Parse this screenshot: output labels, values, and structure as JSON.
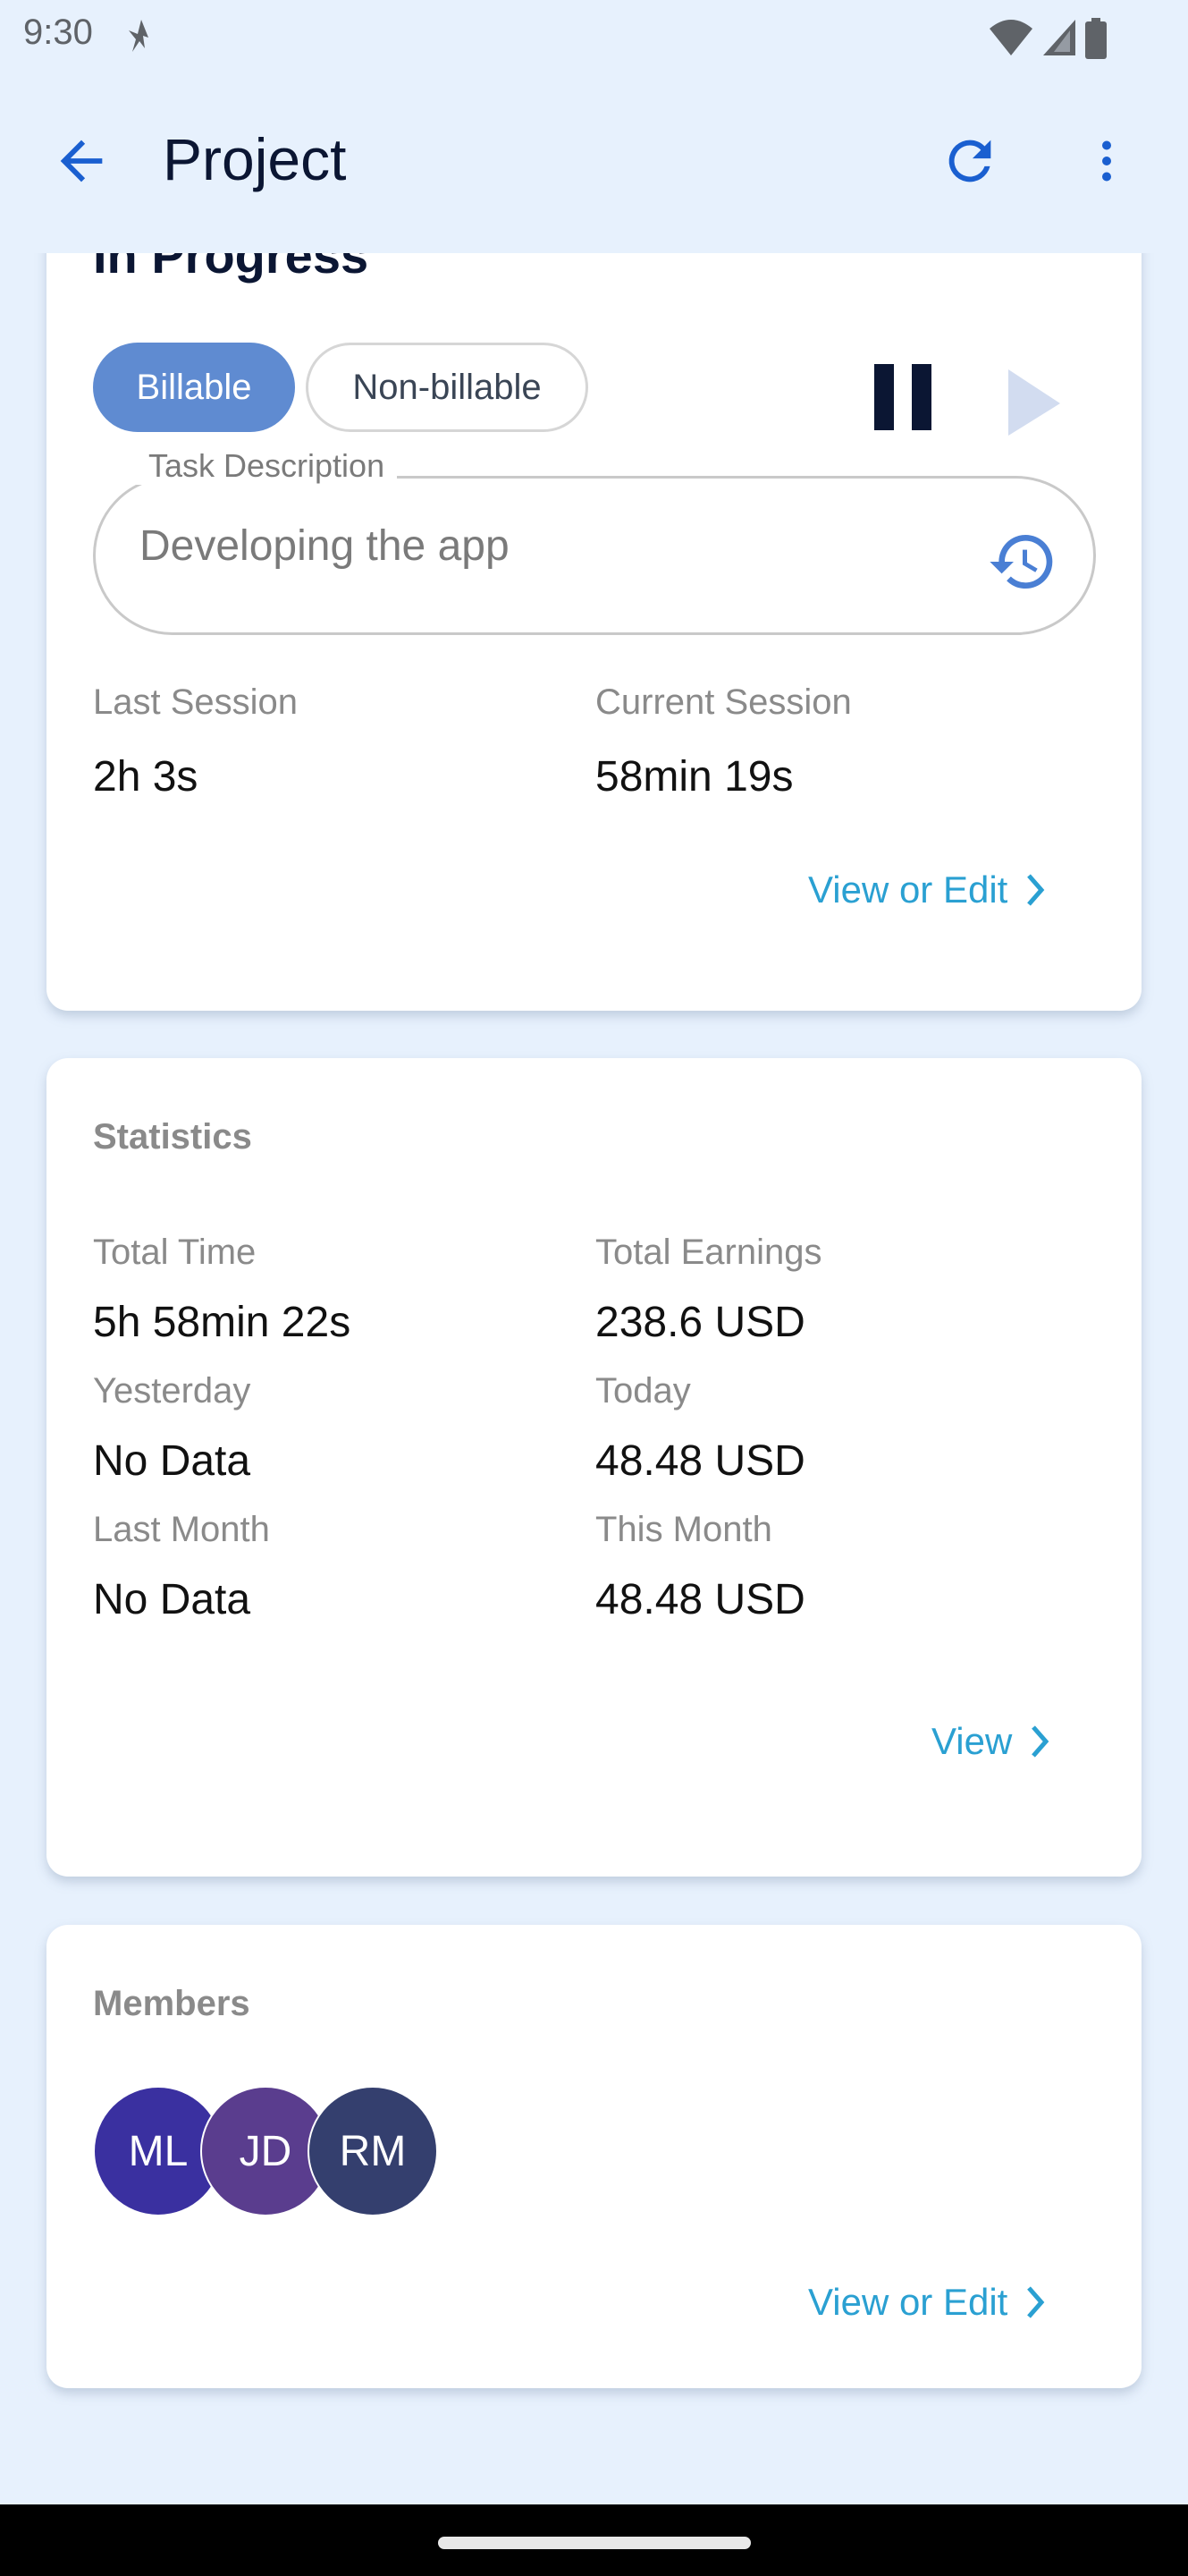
{
  "status_bar": {
    "time": "9:30",
    "icons": [
      "dnd-icon",
      "wifi-icon",
      "signal-icon",
      "battery-icon"
    ]
  },
  "toolbar": {
    "title": "Project",
    "back_icon": "arrow-back-icon",
    "refresh_icon": "refresh-icon",
    "more_icon": "more-vert-icon"
  },
  "timer_card": {
    "status_heading": "In Progress",
    "chips": [
      {
        "label": "Billable",
        "selected": true
      },
      {
        "label": "Non-billable",
        "selected": false
      }
    ],
    "pause_icon": "pause-icon",
    "play_icon": "play-icon",
    "task_field": {
      "label": "Task Description",
      "value": "Developing the app",
      "trailing_icon": "history-icon"
    },
    "last_session": {
      "label": "Last Session",
      "value": "2h 3s"
    },
    "current_session": {
      "label": "Current Session",
      "value": "58min 19s"
    },
    "link": "View or Edit"
  },
  "statistics_card": {
    "title": "Statistics",
    "items": [
      {
        "label": "Total Time",
        "value": "5h 58min 22s"
      },
      {
        "label": "Total Earnings",
        "value": "238.6 USD"
      },
      {
        "label": "Yesterday",
        "value": "No Data"
      },
      {
        "label": "Today",
        "value": "48.48 USD"
      },
      {
        "label": "Last Month",
        "value": "No Data"
      },
      {
        "label": "This Month",
        "value": "48.48 USD"
      }
    ],
    "link": "View"
  },
  "members_card": {
    "title": "Members",
    "members": [
      {
        "initials": "ML",
        "color": "#3a30a0"
      },
      {
        "initials": "JD",
        "color": "#5a3d8e"
      },
      {
        "initials": "RM",
        "color": "#343f6e"
      }
    ],
    "link": "View or Edit"
  },
  "colors": {
    "background": "#e7f1fd",
    "accent": "#1a5fd0",
    "link": "#2aa0d2",
    "chip_selected": "#5f8bd1"
  }
}
